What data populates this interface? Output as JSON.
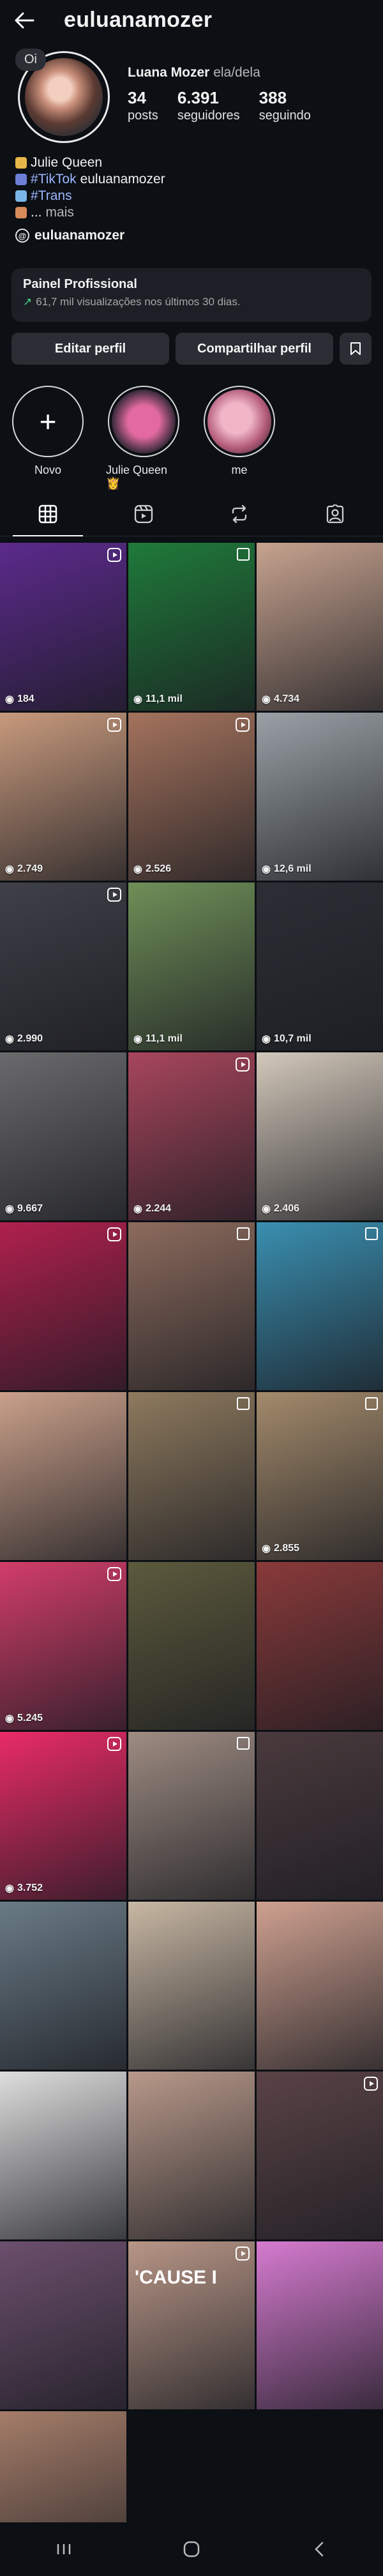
{
  "header": {
    "username": "euluanamozer"
  },
  "note": {
    "text": "Oi"
  },
  "profile": {
    "name": "Luana Mozer",
    "pronouns": "ela/dela",
    "stats": [
      {
        "value": "34",
        "label": "posts"
      },
      {
        "value": "6.391",
        "label": "seguidores"
      },
      {
        "value": "388",
        "label": "seguindo"
      }
    ],
    "bio": {
      "line1": "Julie Queen",
      "line2_tag": "#TikTok",
      "line2_text": "euluanamozer",
      "line3_tag": "#Trans",
      "line4_prefix": "...",
      "line4_more": "mais"
    },
    "threads_handle": "euluanamozer"
  },
  "dashboard": {
    "title": "Painel Profissional",
    "subtitle": "61,7 mil visualizações nos últimos 30 dias."
  },
  "buttons": {
    "edit": "Editar perfil",
    "share": "Compartilhar perfil"
  },
  "highlights": [
    {
      "label": "Novo"
    },
    {
      "label": "Julie Queen 👸"
    },
    {
      "label": "me"
    }
  ],
  "tiles": [
    {
      "views": "184",
      "color": "#5b2a8c",
      "badge": "reel"
    },
    {
      "views": "11,1 mil",
      "color": "#1f7a3a",
      "badge": "multi"
    },
    {
      "views": "4.734",
      "color": "#c7a38f",
      "badge": ""
    },
    {
      "views": "2.749",
      "color": "#c89a7d",
      "badge": "reel"
    },
    {
      "views": "2.526",
      "color": "#a4735d",
      "badge": "reel"
    },
    {
      "views": "12,6 mil",
      "color": "#9aa1a6",
      "badge": ""
    },
    {
      "views": "2.990",
      "color": "#3f4048",
      "badge": "reel"
    },
    {
      "views": "11,1 mil",
      "color": "#6f8f58",
      "badge": ""
    },
    {
      "views": "10,7 mil",
      "color": "#2b2f35",
      "badge": ""
    },
    {
      "views": "9.667",
      "color": "#6a6a6d",
      "badge": ""
    },
    {
      "views": "2.244",
      "color": "#a8465c",
      "badge": "reel"
    },
    {
      "views": "2.406",
      "color": "#d3c8ba",
      "badge": ""
    },
    {
      "views": "",
      "color": "#b0204e",
      "badge": "reel"
    },
    {
      "views": "",
      "color": "#8c6b5d",
      "badge": "multi"
    },
    {
      "views": "",
      "color": "#3a8fb0",
      "badge": "multi"
    },
    {
      "views": "",
      "color": "#caa08a",
      "badge": ""
    },
    {
      "views": "",
      "color": "#8e7a5e",
      "badge": "multi"
    },
    {
      "views": "2.855",
      "color": "#a38a6b",
      "badge": "multi"
    },
    {
      "views": "5.245",
      "color": "#d23d6a",
      "badge": "reel"
    },
    {
      "views": "",
      "color": "#5c5a3c",
      "badge": ""
    },
    {
      "views": "",
      "color": "#8a3a3a",
      "badge": ""
    },
    {
      "views": "3.752",
      "color": "#ea2b67",
      "badge": "reel"
    },
    {
      "views": "",
      "color": "#9e8c82",
      "badge": "multi"
    },
    {
      "views": "",
      "color": "#4a3a3d",
      "badge": ""
    },
    {
      "views": "",
      "color": "#6a7b86",
      "badge": ""
    },
    {
      "views": "",
      "color": "#c8b7a3",
      "badge": ""
    },
    {
      "views": "",
      "color": "#cfa190",
      "badge": ""
    },
    {
      "views": "",
      "color": "#dedede",
      "badge": ""
    },
    {
      "views": "",
      "color": "#b8998a",
      "badge": ""
    },
    {
      "views": "",
      "color": "#5a4346",
      "badge": "reel"
    },
    {
      "views": "",
      "color": "#6c4f6d",
      "badge": ""
    },
    {
      "views": "",
      "color": "#b89687",
      "badge": "reel",
      "text": "'CAUSE I"
    },
    {
      "views": "",
      "color": "#d67bd0",
      "badge": ""
    },
    {
      "views": "",
      "color": "#a57d69",
      "badge": ""
    }
  ]
}
